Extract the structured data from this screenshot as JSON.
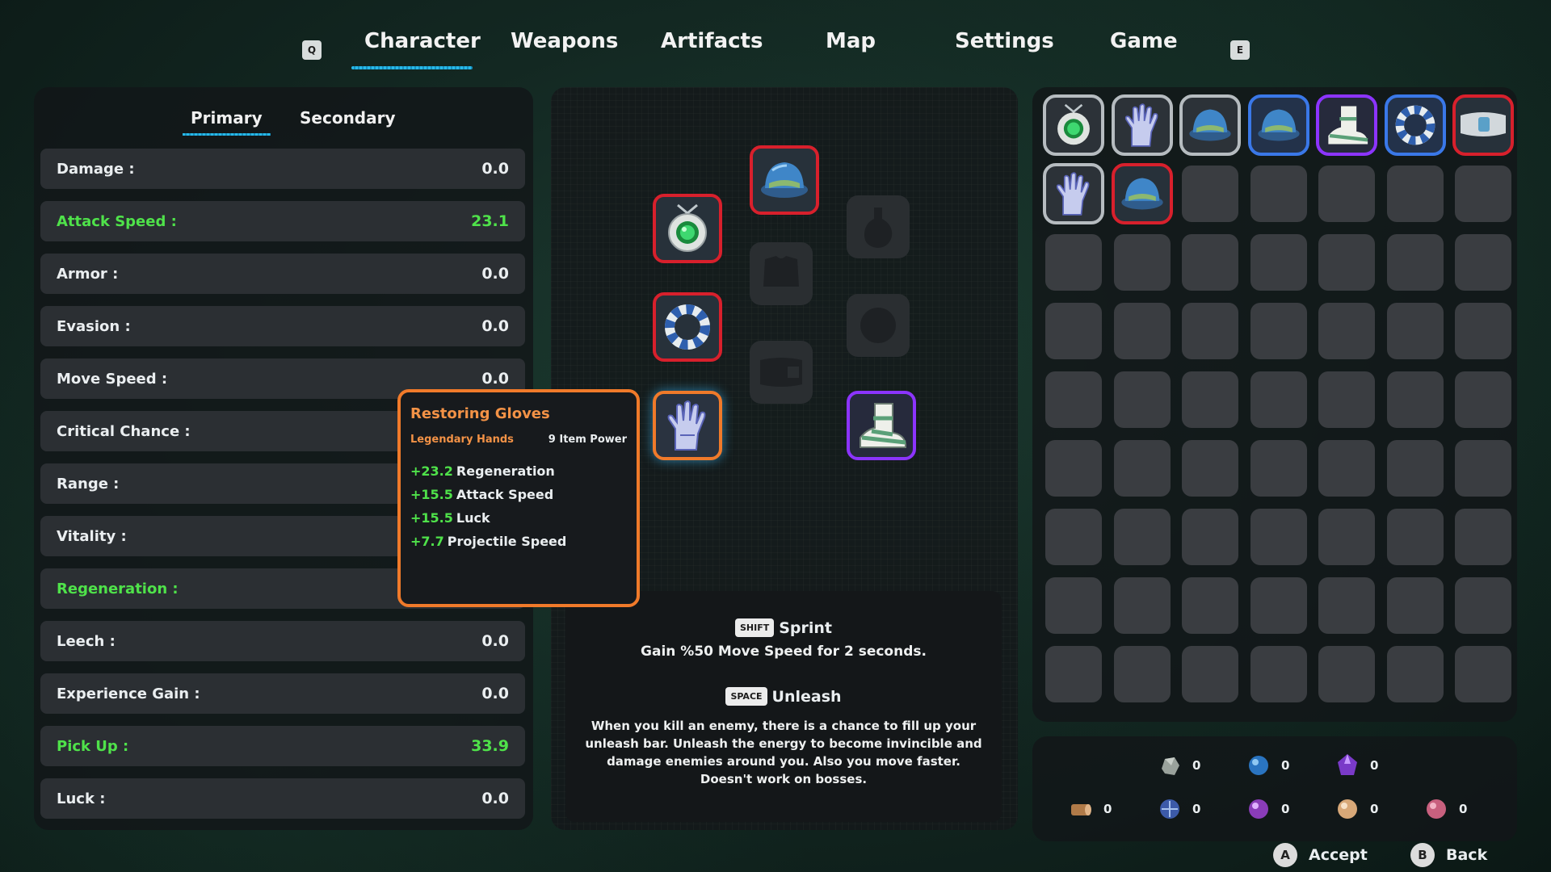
{
  "nav": {
    "prev_key": "Q",
    "next_key": "E",
    "tabs": [
      "Character",
      "Weapons",
      "Artifacts",
      "Map",
      "Settings",
      "Game"
    ],
    "active_tab": "Character"
  },
  "stats": {
    "subtabs": [
      "Primary",
      "Secondary"
    ],
    "active_subtab": "Primary",
    "rows": [
      {
        "label": "Damage :",
        "value": "0.0"
      },
      {
        "label": "Attack Speed :",
        "value": "23.1"
      },
      {
        "label": "Armor :",
        "value": "0.0"
      },
      {
        "label": "Evasion :",
        "value": "0.0"
      },
      {
        "label": "Move Speed :",
        "value": "0.0"
      },
      {
        "label": "Critical Chance :",
        "value": ""
      },
      {
        "label": "Range :",
        "value": ""
      },
      {
        "label": "Vitality :",
        "value": ""
      },
      {
        "label": "Regeneration :",
        "value": ""
      },
      {
        "label": "Leech :",
        "value": "0.0"
      },
      {
        "label": "Experience Gain :",
        "value": "0.0"
      },
      {
        "label": "Pick Up :",
        "value": "33.9"
      },
      {
        "label": "Luck :",
        "value": "0.0"
      }
    ]
  },
  "tooltip": {
    "name": "Restoring Gloves",
    "rarity_slot": "Legendary Hands",
    "item_power": "9 Item Power",
    "bonuses": [
      {
        "amount": "+23.2",
        "stat": "Regeneration"
      },
      {
        "amount": "+15.5",
        "stat": "Attack Speed"
      },
      {
        "amount": "+15.5",
        "stat": "Luck"
      },
      {
        "amount": "+7.7",
        "stat": "Projectile Speed"
      }
    ]
  },
  "abilities": {
    "sprint": {
      "key": "SHIFT",
      "name": "Sprint",
      "desc": "Gain %50 Move Speed for 2 seconds."
    },
    "unleash": {
      "key": "SPACE",
      "name": "Unleash",
      "desc": "When you kill an enemy, there is a chance to fill up your unleash bar. Unleash the energy to become invincible and damage enemies around you. Also you move faster. Doesn't work on bosses."
    }
  },
  "materials": [
    {
      "icon": "stone-ore-icon",
      "count": "0"
    },
    {
      "icon": "blue-orb-icon",
      "count": "0"
    },
    {
      "icon": "purple-crystal-icon",
      "count": "0"
    },
    {
      "icon": "wood-log-icon",
      "count": "0"
    },
    {
      "icon": "blue-shell-icon",
      "count": "0"
    },
    {
      "icon": "purple-shard-icon",
      "count": "0"
    },
    {
      "icon": "peach-orb-icon",
      "count": "0"
    },
    {
      "icon": "pink-shell-icon",
      "count": "0"
    }
  ],
  "prompts": {
    "accept_key": "A",
    "accept_label": "Accept",
    "back_key": "B",
    "back_label": "Back"
  },
  "colors": {
    "accent": "#28b9e8",
    "highlight_green": "#4fe24a",
    "legendary_orange": "#f07a2a",
    "rare_red": "#d8202c",
    "epic_purple": "#8c34ff",
    "uncommon_blue": "#3a78e8"
  }
}
